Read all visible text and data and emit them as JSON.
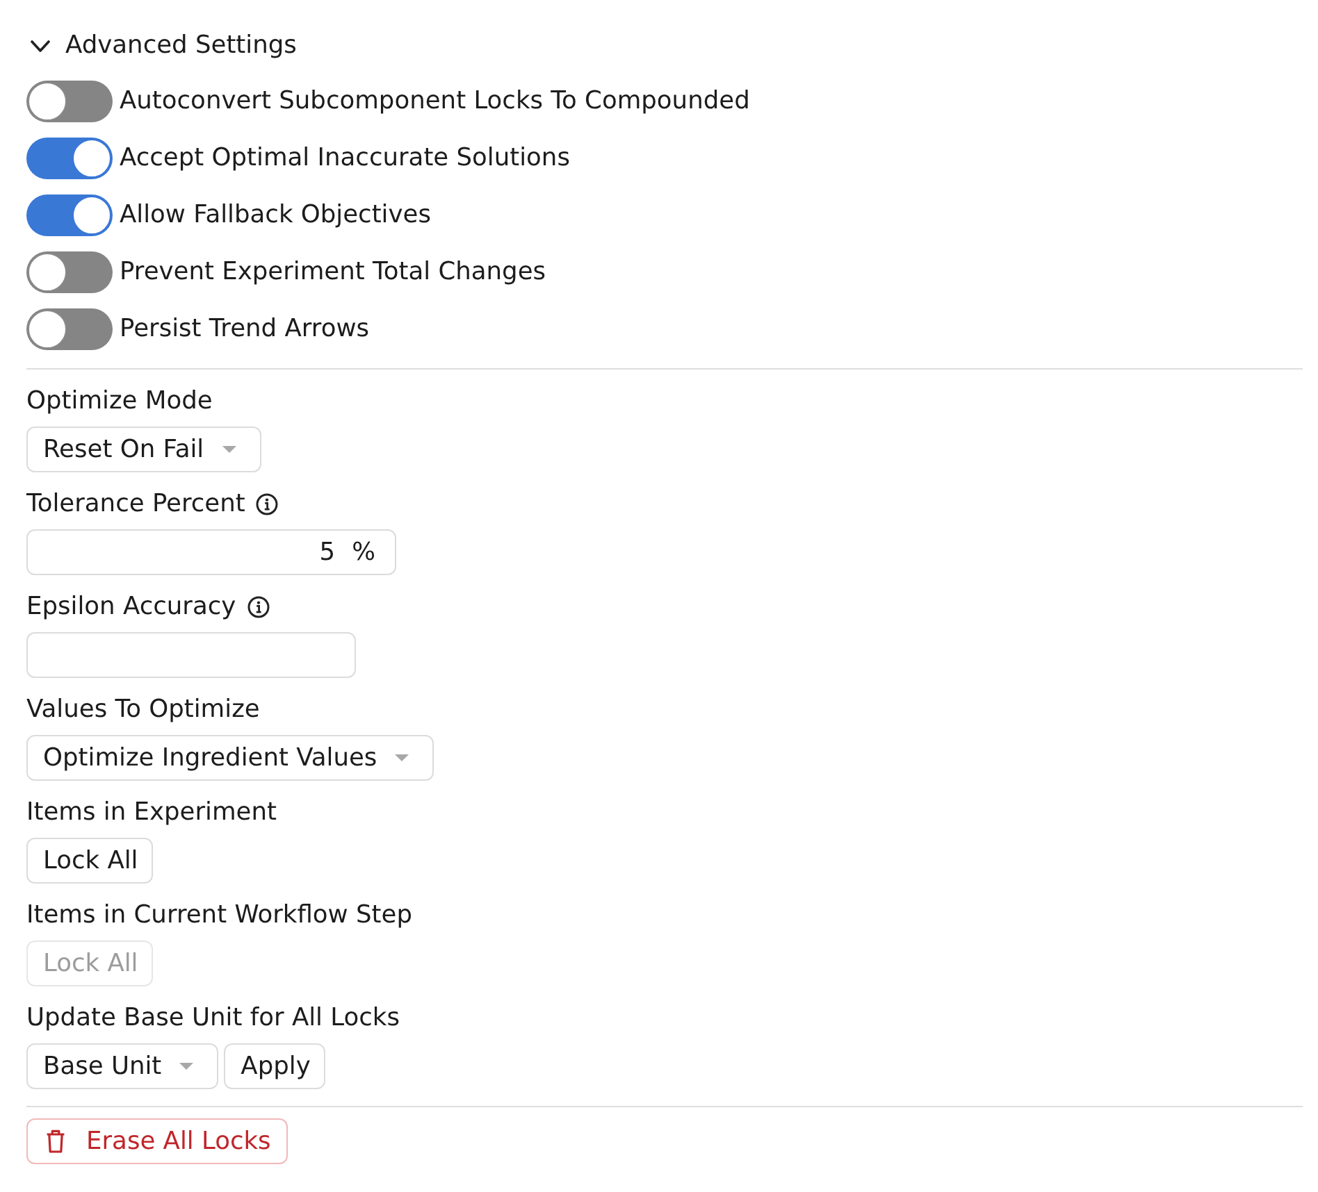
{
  "section": {
    "title": "Advanced Settings",
    "expanded": true
  },
  "toggles": [
    {
      "label": "Autoconvert Subcomponent Locks To Compounded",
      "on": false
    },
    {
      "label": "Accept Optimal Inaccurate Solutions",
      "on": true
    },
    {
      "label": "Allow Fallback Objectives",
      "on": true
    },
    {
      "label": "Prevent Experiment Total Changes",
      "on": false
    },
    {
      "label": "Persist Trend Arrows",
      "on": false
    }
  ],
  "fields": [
    {
      "kind": "select",
      "label": "Optimize Mode",
      "info": false,
      "value": "Reset On Fail"
    },
    {
      "kind": "percent",
      "label": "Tolerance Percent",
      "info": true,
      "value": "5",
      "unit": "%"
    },
    {
      "kind": "text",
      "label": "Epsilon Accuracy",
      "info": true
    },
    {
      "kind": "select",
      "label": "Values To Optimize",
      "info": false,
      "value": "Optimize Ingredient Values"
    },
    {
      "kind": "button",
      "label": "Items in Experiment",
      "info": false,
      "button": "Lock All",
      "disabled": false
    },
    {
      "kind": "button",
      "label": "Items in Current Workflow Step",
      "info": false,
      "button": "Lock All",
      "disabled": true
    },
    {
      "kind": "select_apply",
      "label": "Update Base Unit for All Locks",
      "info": false,
      "value": "Base Unit",
      "button": "Apply"
    }
  ],
  "erase_button": {
    "label": "Erase All Locks"
  }
}
